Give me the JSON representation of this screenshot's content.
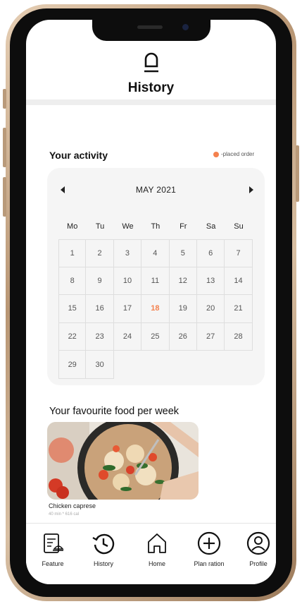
{
  "header": {
    "title": "History"
  },
  "activity": {
    "title": "Your activity",
    "legend": "-placed order",
    "legend_color": "#f4814e"
  },
  "calendar": {
    "month_label": "MAY 2021",
    "weekdays": [
      "Mo",
      "Tu",
      "We",
      "Th",
      "Fr",
      "Sa",
      "Su"
    ],
    "weeks": [
      [
        "1",
        "2",
        "3",
        "4",
        "5",
        "6",
        "7"
      ],
      [
        "8",
        "9",
        "10",
        "11",
        "12",
        "13",
        "14"
      ],
      [
        "15",
        "16",
        "17",
        "18",
        "19",
        "20",
        "21"
      ],
      [
        "22",
        "23",
        "24",
        "25",
        "26",
        "27",
        "28"
      ],
      [
        "29",
        "30",
        "",
        "",
        "",
        "",
        ""
      ]
    ],
    "highlighted_day": "18"
  },
  "favourite": {
    "title": "Your favourite food per week",
    "food_name": "Chicken caprese",
    "food_meta": "40 min * 616 cal"
  },
  "nav": {
    "items": [
      {
        "label": "Feature",
        "icon": "feature-icon"
      },
      {
        "label": "History",
        "icon": "history-icon"
      },
      {
        "label": "Home",
        "icon": "home-icon"
      },
      {
        "label": "Plan ration",
        "icon": "plus-circle-icon"
      },
      {
        "label": "Profile",
        "icon": "profile-icon"
      }
    ]
  }
}
